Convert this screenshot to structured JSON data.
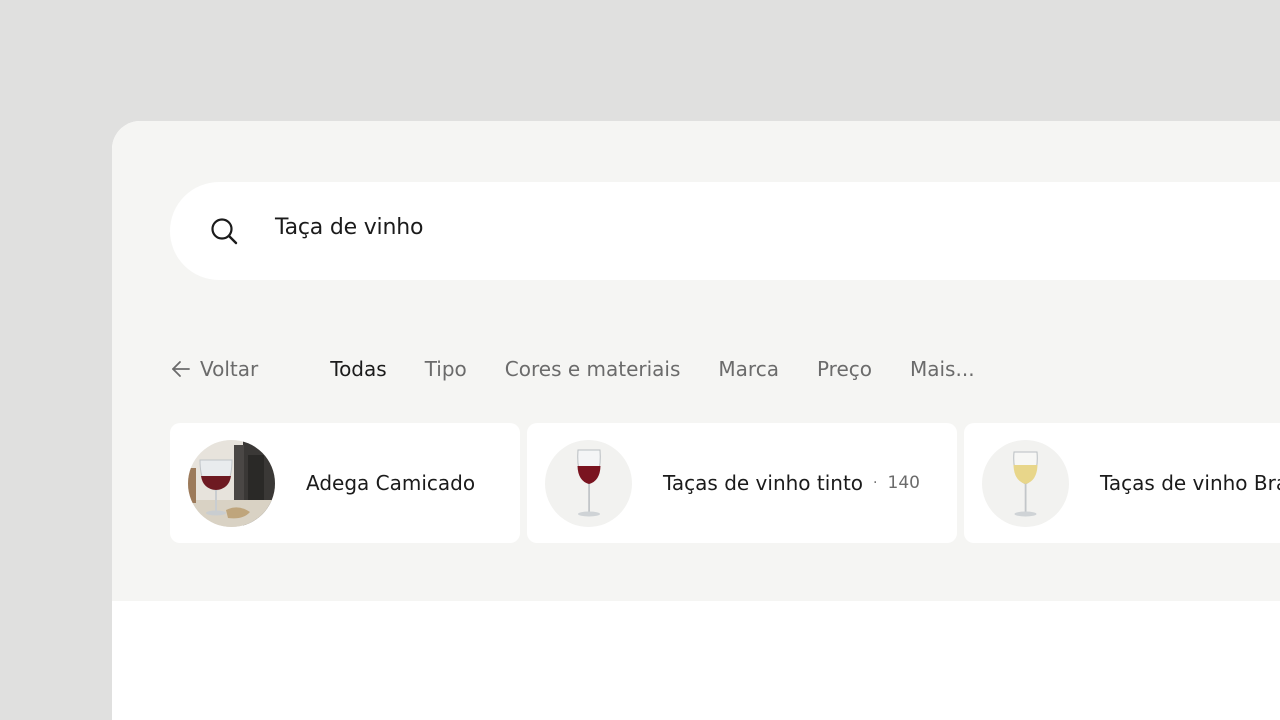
{
  "search": {
    "icon": "search-icon",
    "query": "Taça de vinho"
  },
  "filters": {
    "back_label": "Voltar",
    "back_icon": "arrow-left-icon",
    "tabs": [
      {
        "label": "Todas",
        "active": true
      },
      {
        "label": "Tipo",
        "active": false
      },
      {
        "label": "Cores e materiais",
        "active": false
      },
      {
        "label": "Marca",
        "active": false
      },
      {
        "label": "Preço",
        "active": false
      },
      {
        "label": "Mais...",
        "active": false
      }
    ]
  },
  "suggestions": [
    {
      "label": "Adega Camicado",
      "image": "wine-glass-and-bottles-photo"
    },
    {
      "label": "Taças de vinho tinto",
      "count": "140",
      "separator": "·",
      "image": "red-wine-glass-photo"
    },
    {
      "label": "Taças de vinho Branco",
      "image": "white-wine-glass-photo"
    }
  ],
  "colors": {
    "background": "#e0e0df",
    "panel": "#f5f5f3",
    "text": "#1b1b1b",
    "muted_text": "#6b6b6b",
    "red_wine": "#7a1420",
    "white_wine": "#e8d68a"
  }
}
